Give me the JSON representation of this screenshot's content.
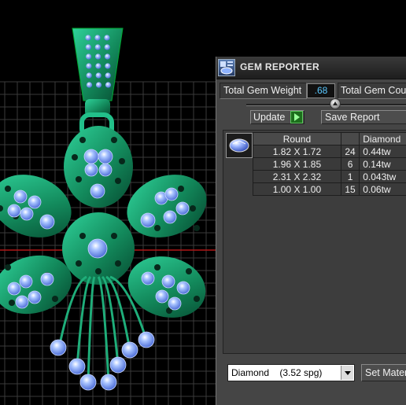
{
  "panel": {
    "title": "GEM REPORTER",
    "total_weight_label": "Total Gem Weight",
    "total_weight_value": ".68",
    "total_count_label": "Total Gem Cou",
    "update_label": "Update",
    "save_report_label": "Save Report",
    "table": {
      "headers": [
        "Round",
        "",
        "Diamond"
      ],
      "rows": [
        [
          "1.82 X 1.72",
          "24",
          "0.44tw"
        ],
        [
          "1.96 X 1.85",
          "6",
          "0.14tw"
        ],
        [
          "2.31 X 2.32",
          "1",
          "0.043tw"
        ],
        [
          "1.00 X 1.00",
          "15",
          "0.06tw"
        ]
      ]
    },
    "material_select_value": "Diamond    (3.52 spg)",
    "set_material_label": "Set Mater"
  },
  "colors": {
    "metal": "#1f9e6e",
    "gem": "#7fa8ff",
    "grid": "#3a3a3a",
    "axis": "#b01818"
  }
}
